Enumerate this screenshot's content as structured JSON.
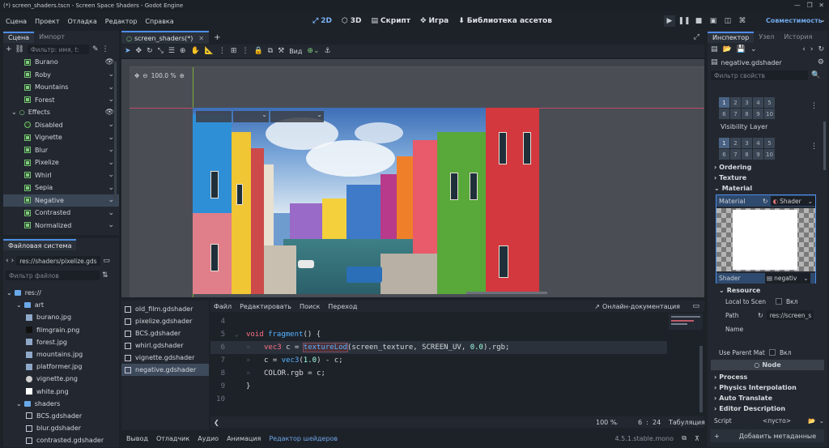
{
  "titlebar": {
    "text": "(*) screen_shaders.tscn - Screen Space Shaders - Godot Engine"
  },
  "menubar": {
    "items": [
      "Сцена",
      "Проект",
      "Отладка",
      "Редактор",
      "Справка"
    ],
    "workspaces": [
      "2D",
      "3D",
      "Скрипт",
      "Игра",
      "Библиотека ассетов"
    ],
    "compat": "Совместимость"
  },
  "scene_panel": {
    "tabs": [
      "Сцена",
      "Импорт"
    ],
    "filter_placeholder": "Фильтр: имя, t:",
    "nodes": [
      {
        "label": "Burano",
        "level": 2,
        "sel": false,
        "icon": "eye"
      },
      {
        "label": "Roby",
        "level": 2,
        "sel": false,
        "icon": "chevron"
      },
      {
        "label": "Mountains",
        "level": 2,
        "sel": false,
        "icon": "chevron"
      },
      {
        "label": "Forest",
        "level": 2,
        "sel": false,
        "icon": "chevron"
      },
      {
        "label": "Effects",
        "level": 1,
        "sel": false,
        "icon": "eye"
      },
      {
        "label": "Disabled",
        "level": 2,
        "sel": false,
        "icon": "chevron"
      },
      {
        "label": "Vignette",
        "level": 2,
        "sel": false,
        "icon": "chevron"
      },
      {
        "label": "Blur",
        "level": 2,
        "sel": false,
        "icon": "chevron"
      },
      {
        "label": "Pixelize",
        "level": 2,
        "sel": false,
        "icon": "chevron"
      },
      {
        "label": "Whirl",
        "level": 2,
        "sel": false,
        "icon": "chevron"
      },
      {
        "label": "Sepia",
        "level": 2,
        "sel": false,
        "icon": "chevron"
      },
      {
        "label": "Negative",
        "level": 2,
        "sel": true,
        "icon": "chevron"
      },
      {
        "label": "Contrasted",
        "level": 2,
        "sel": false,
        "icon": "chevron"
      },
      {
        "label": "Normalized",
        "level": 2,
        "sel": false,
        "icon": "chevron"
      }
    ]
  },
  "filesystem": {
    "title": "Файловая система",
    "path": "res://shaders/pixelize.gds",
    "filter_placeholder": "Фильтр файлов",
    "items": [
      {
        "label": "res://",
        "level": 0,
        "type": "folder"
      },
      {
        "label": "art",
        "level": 1,
        "type": "folder"
      },
      {
        "label": "burano.jpg",
        "level": 2,
        "type": "img"
      },
      {
        "label": "filmgrain.png",
        "level": 2,
        "type": "dark"
      },
      {
        "label": "forest.jpg",
        "level": 2,
        "type": "img"
      },
      {
        "label": "mountains.jpg",
        "level": 2,
        "type": "img"
      },
      {
        "label": "platformer.jpg",
        "level": 2,
        "type": "img"
      },
      {
        "label": "vignette.png",
        "level": 2,
        "type": "circle"
      },
      {
        "label": "white.png",
        "level": 2,
        "type": "white"
      },
      {
        "label": "shaders",
        "level": 1,
        "type": "folder"
      },
      {
        "label": "BCS.gdshader",
        "level": 2,
        "type": "shader"
      },
      {
        "label": "blur.gdshader",
        "level": 2,
        "type": "shader"
      },
      {
        "label": "contrasted.gdshader",
        "level": 2,
        "type": "shader"
      }
    ]
  },
  "editor_tabs": {
    "tab": "screen_shaders(*)"
  },
  "toolbar": {
    "view": "Вид"
  },
  "viewport": {
    "zoom": "100.0 %"
  },
  "shader_list": [
    "old_film.gdshader",
    "pixelize.gdshader",
    "BCS.gdshader",
    "whirl.gdshader",
    "vignette.gdshader",
    "negative.gdshader"
  ],
  "shader_editor": {
    "menu": [
      "Файл",
      "Редактировать",
      "Поиск",
      "Переход"
    ],
    "docs": "Онлайн-документация",
    "lines": [
      {
        "n": "4",
        "tokens": []
      },
      {
        "n": "5",
        "tokens": [
          [
            "kw",
            "void "
          ],
          [
            "fn",
            "fragment"
          ],
          [
            "t",
            "() {"
          ]
        ]
      },
      {
        "n": "6",
        "tokens": [
          [
            "kw",
            "vec3 "
          ],
          [
            "t",
            "c = "
          ],
          [
            "fn",
            "textureLod"
          ],
          [
            "t",
            "(screen_texture, SCREEN_UV, "
          ],
          [
            "num",
            "0.0"
          ],
          [
            "t",
            ").rgb;"
          ]
        ]
      },
      {
        "n": "7",
        "tokens": [
          [
            "t",
            "c = "
          ],
          [
            "fn",
            "vec3"
          ],
          [
            "t",
            "("
          ],
          [
            "num",
            "1.0"
          ],
          [
            "t",
            ") - c;"
          ]
        ]
      },
      {
        "n": "8",
        "tokens": [
          [
            "t",
            "COLOR.rgb = c;"
          ]
        ]
      },
      {
        "n": "9",
        "tokens": [
          [
            "t",
            "}"
          ]
        ]
      },
      {
        "n": "10",
        "tokens": []
      }
    ],
    "zoom": "100 %",
    "cursor_line": "6",
    "cursor_col": "24",
    "indent": "Табуляция"
  },
  "bottom_tabs": [
    "Вывод",
    "Отладчик",
    "Аудио",
    "Анимация",
    "Редактор шейдеров"
  ],
  "version": "4.5.1.stable.mono",
  "inspector": {
    "tabs": [
      "Инспектор",
      "Узел",
      "История"
    ],
    "resource": "negative.gdshader",
    "filter_placeholder": "Фильтр свойств",
    "layer_cells": [
      "1",
      "2",
      "3",
      "4",
      "5",
      "6",
      "7",
      "8",
      "9",
      "10"
    ],
    "visibility_layer": "Visibility Layer",
    "sections": [
      "Ordering",
      "Texture",
      "Material"
    ],
    "material_label": "Material",
    "shader_type": "Shader",
    "shader_label": "Shader",
    "shader_value": "negativ",
    "resource_section": "Resource",
    "local_to_scene": "Local to Scen",
    "local_value": "Вкл",
    "path_label": "Path",
    "path_value": "res://screen_s",
    "name_label": "Name",
    "use_parent": "Use Parent Mat",
    "use_parent_value": "Вкл",
    "node_header": "Node",
    "node_sections": [
      "Process",
      "Physics Interpolation",
      "Auto Translate",
      "Editor Description"
    ],
    "script_label": "Script",
    "script_value": "<пусто>",
    "add_meta": "Добавить метаданные"
  }
}
